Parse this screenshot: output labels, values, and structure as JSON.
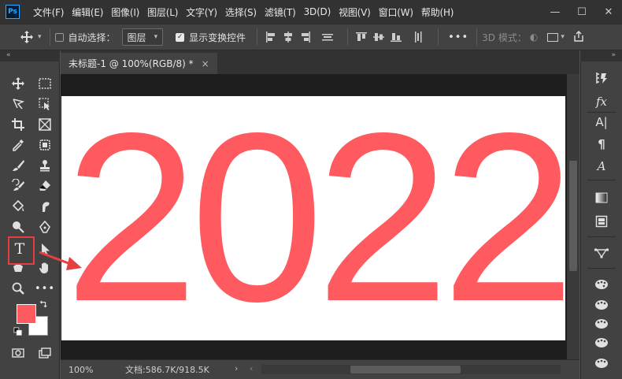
{
  "app": {
    "logo_text": "Ps"
  },
  "menu": [
    "文件(F)",
    "编辑(E)",
    "图像(I)",
    "图层(L)",
    "文字(Y)",
    "选择(S)",
    "滤镜(T)",
    "3D(D)",
    "视图(V)",
    "窗口(W)",
    "帮助(H)"
  ],
  "window_controls": {
    "minimize": "—",
    "maximize": "☐",
    "close": "✕"
  },
  "options": {
    "auto_select_label": "自动选择：",
    "auto_select_checked": false,
    "layer_select_value": "图层",
    "show_transform_label": "显示变换控件",
    "show_transform_checked": true,
    "more": "•••",
    "mode_label": "3D 模式：",
    "collapse_glyph": "«"
  },
  "document": {
    "tab_title": "未标题-1 @ 100%(RGB/8) *",
    "tab_close": "×",
    "canvas_text": "2022",
    "text_color": "#fe5a5f"
  },
  "tools": {
    "foreground_color": "#fe5a5f",
    "background_color": "#ffffff",
    "more_tools": "•••",
    "type_tool_glyph": "T"
  },
  "status": {
    "zoom": "100%",
    "doc_size": "文档:586.7K/918.5K",
    "nav_next": "›",
    "nav_prev": "‹"
  },
  "right_panel": {
    "fx_label": "fx",
    "char_label": "A|",
    "para_label": "¶",
    "glyph_label": "A"
  },
  "highlight_color": "#e5403f"
}
